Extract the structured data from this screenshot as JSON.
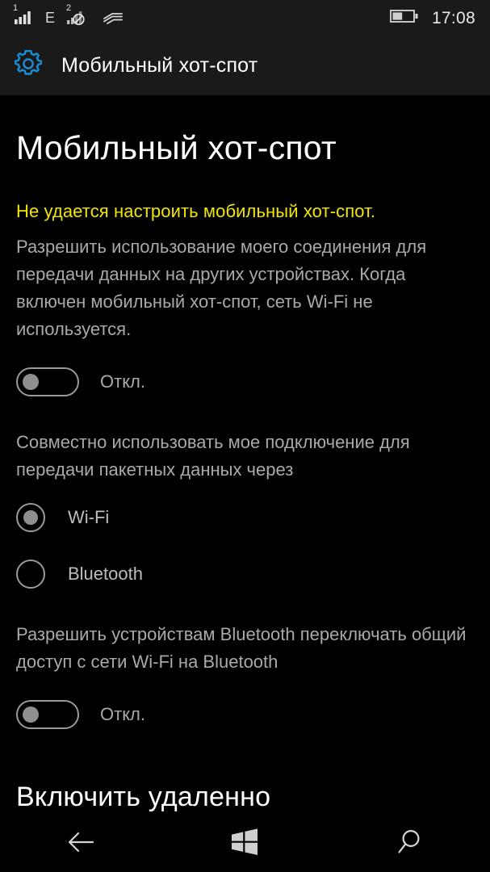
{
  "status_bar": {
    "signal_1_label": "1",
    "network_type": "E",
    "signal_2_label": "2",
    "icons": [
      "signal-bars-sim1",
      "edge-network",
      "signal-bars-sim2-blocked",
      "airplane-waves"
    ],
    "battery_percent": 45,
    "clock": "17:08"
  },
  "app_bar": {
    "icon": "gear-icon",
    "title": "Мобильный хот-спот",
    "accent_color": "#1a8fd6"
  },
  "page": {
    "title": "Мобильный хот-спот",
    "warning": "Не удается настроить мобильный хот-спот.",
    "warning_color": "#f2e500",
    "description": "Разрешить использование моего соединения для передачи данных на других устройствах. Когда включен мобильный хот-спот, сеть Wi-Fi не используется.",
    "hotspot_toggle": {
      "state": "off",
      "label": "Откл."
    },
    "share_section_label": "Совместно использовать мое подключение для передачи пакетных данных через",
    "share_options": [
      {
        "label": "Wi-Fi",
        "selected": true
      },
      {
        "label": "Bluetooth",
        "selected": false
      }
    ],
    "bluetooth_section_label": "Разрешить устройствам Bluetooth переключать общий доступ с сети Wi-Fi на Bluetooth",
    "bluetooth_toggle": {
      "state": "off",
      "label": "Откл."
    },
    "next_section_title": "Включить удаленно"
  },
  "nav_bar": {
    "back_label": "back-arrow-icon",
    "home_label": "windows-home-icon",
    "search_label": "search-icon"
  }
}
